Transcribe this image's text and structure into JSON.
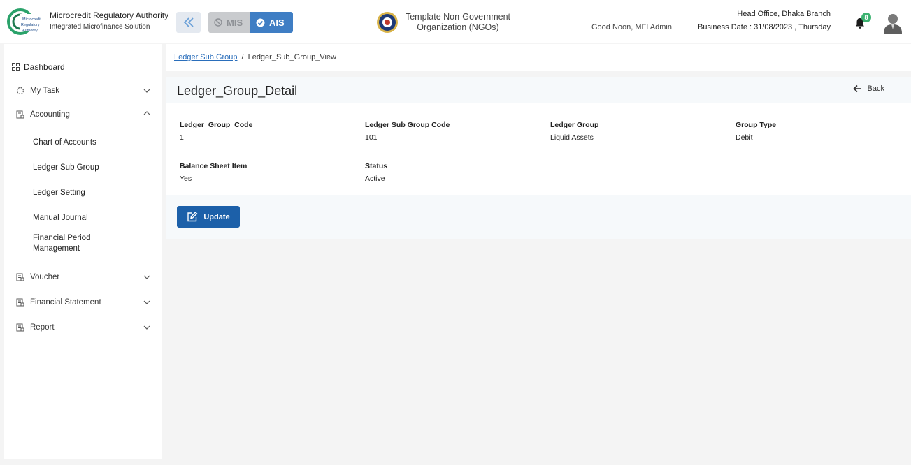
{
  "header": {
    "brand_title": "Microcredit Regulatory Authority",
    "brand_subtitle": "Integrated Microfinance Solution",
    "logo_text": [
      "Microcredit",
      "Regulatory",
      "Authority"
    ],
    "mode_mis": "MIS",
    "mode_ais": "AIS",
    "org_name_line1": "Template Non-Government",
    "org_name_line2": "Organization (NGOs)",
    "greeting": "Good Noon, MFI Admin",
    "branch": "Head Office, Dhaka Branch",
    "business_date": "Business Date : 31/08/2023 , Thursday",
    "notification_count": "8",
    "colors": {
      "accent": "#3f7ec4",
      "badge": "#3cb371",
      "primary_button": "#1c60a9"
    }
  },
  "sidebar": {
    "dashboard": "Dashboard",
    "items": [
      {
        "label": "My Task",
        "icon": "circle-dashed-icon",
        "expanded": false
      },
      {
        "label": "Accounting",
        "icon": "ledger-icon",
        "expanded": true
      },
      {
        "label": "Voucher",
        "icon": "ledger-icon",
        "expanded": false
      },
      {
        "label": "Financial Statement",
        "icon": "ledger-icon",
        "expanded": false
      },
      {
        "label": "Report",
        "icon": "ledger-icon",
        "expanded": false
      }
    ],
    "accounting_children": [
      {
        "label": "Chart of Accounts"
      },
      {
        "label": "Ledger Sub Group"
      },
      {
        "label": "Ledger Setting"
      },
      {
        "label": "Manual Journal"
      },
      {
        "label": "Financial Period Management"
      }
    ]
  },
  "breadcrumb": {
    "parent": "Ledger Sub Group",
    "current": "Ledger_Sub_Group_View"
  },
  "detail": {
    "title": "Ledger_Group_Detail",
    "back_label": "Back",
    "fields": [
      {
        "label": "Ledger_Group_Code",
        "value": "1"
      },
      {
        "label": "Ledger Sub Group Code",
        "value": "101"
      },
      {
        "label": "Ledger Group",
        "value": "Liquid Assets"
      },
      {
        "label": "Group Type",
        "value": "Debit"
      },
      {
        "label": "Balance Sheet Item",
        "value": "Yes"
      },
      {
        "label": "Status",
        "value": "Active"
      }
    ],
    "update_label": "Update"
  }
}
